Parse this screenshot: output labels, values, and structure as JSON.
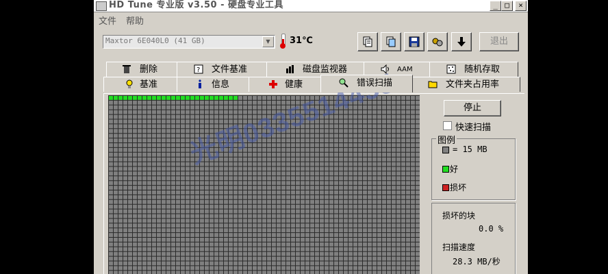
{
  "window": {
    "title": "HD Tune 专业版 v3.50 - 硬盘专业工具",
    "controls": [
      "_",
      "□",
      "×"
    ]
  },
  "menu": [
    "文件",
    "帮助"
  ],
  "toolbar": {
    "drive_value": "Maxtor 6E040L0 (41 GB)",
    "temperature": "31℃",
    "exit_label": "退出",
    "buttons": [
      {
        "icon": "copy-text-icon"
      },
      {
        "icon": "copy-screenshot-icon"
      },
      {
        "icon": "save-icon"
      },
      {
        "icon": "options-icon"
      },
      {
        "icon": "download-arrow-icon"
      }
    ]
  },
  "tabs_back": [
    {
      "label": "删除",
      "icon": "trash-icon"
    },
    {
      "label": "文件基准",
      "icon": "file-benchmark-icon"
    },
    {
      "label": "磁盘监视器",
      "icon": "disk-monitor-icon"
    },
    {
      "label": "AAM",
      "icon": "speaker-icon"
    },
    {
      "label": "随机存取",
      "icon": "random-access-icon"
    }
  ],
  "tabs_front": [
    {
      "label": "基准",
      "icon": "bulb-icon"
    },
    {
      "label": "信息",
      "icon": "info-icon"
    },
    {
      "label": "健康",
      "icon": "health-cross-icon"
    },
    {
      "label": "错误扫描",
      "icon": "magnifier-icon",
      "active": true
    },
    {
      "label": "文件夹占用率",
      "icon": "folder-icon"
    }
  ],
  "scan": {
    "stop_label": "停止",
    "quick_scan_label": "快速扫描",
    "quick_scan_checked": false,
    "progress_ratio": 0.42,
    "colors": {
      "good": "#22dd22",
      "bad": "#cc2222",
      "pending": "#808080",
      "grid_line": "#2a2a2a"
    }
  },
  "legend": {
    "title": "图例",
    "block_size": "= 15 MB",
    "good": "好",
    "bad": "损坏"
  },
  "stats": {
    "damaged_label": "损坏的块",
    "damaged_value": "0.0 %",
    "speed_label": "扫描速度",
    "speed_value": "28.3 MB/秒"
  },
  "watermark": "光明0335514455"
}
